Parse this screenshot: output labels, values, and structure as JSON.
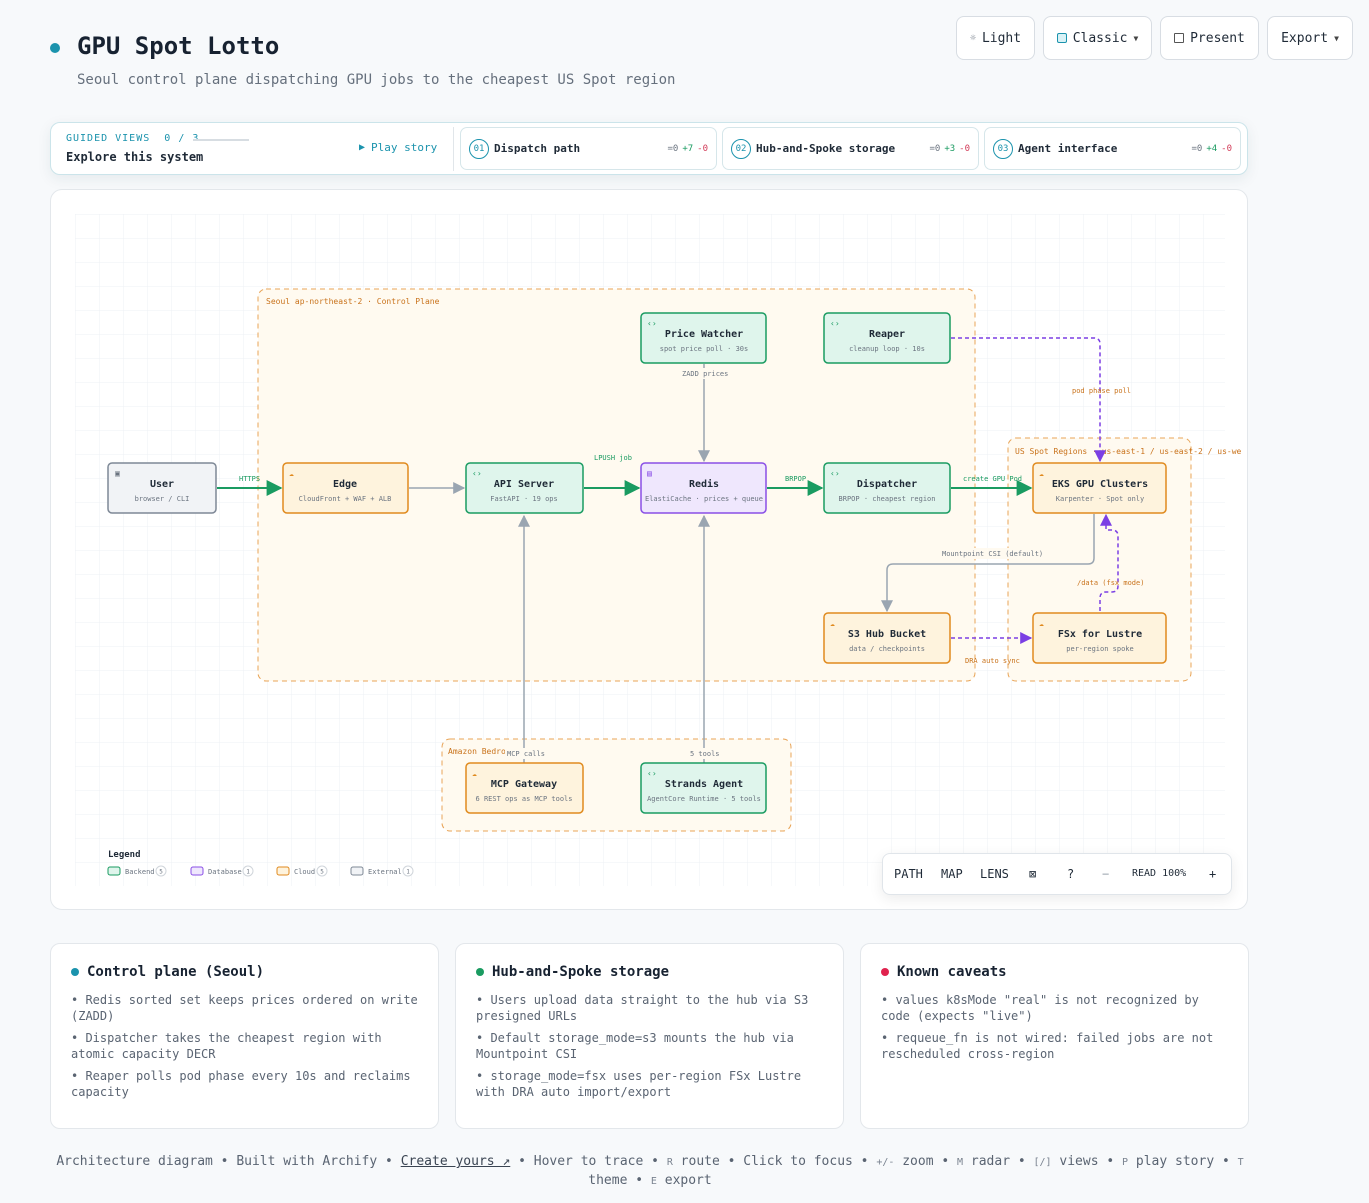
{
  "header": {
    "title": "GPU Spot Lotto",
    "subtitle": "Seoul control plane dispatching GPU jobs to the cheapest US Spot region",
    "accent": "#1b93ad"
  },
  "top_buttons": {
    "light": "Light",
    "classic": "Classic",
    "present": "Present",
    "export": "Export"
  },
  "guided": {
    "label": "GUIDED VIEWS",
    "progress": "0 / 3",
    "explore": "Explore this system",
    "play": "Play story",
    "views": [
      {
        "num": "01",
        "title": "Dispatch path",
        "eq": "=0",
        "plus": "+7",
        "minus": "-0"
      },
      {
        "num": "02",
        "title": "Hub-and-Spoke storage",
        "eq": "=0",
        "plus": "+3",
        "minus": "-0"
      },
      {
        "num": "03",
        "title": "Agent interface",
        "eq": "=0",
        "plus": "+4",
        "minus": "-0"
      }
    ]
  },
  "diagram": {
    "groups": {
      "seoul": "Seoul ap-northeast-2 · Control Plane",
      "us": "US Spot Regions · us-east-1 / us-east-2 / us-we",
      "amazon": "Amazon Bedro    re"
    },
    "nodes": {
      "user": {
        "title": "User",
        "sub": "browser / CLI"
      },
      "edge": {
        "title": "Edge",
        "sub": "CloudFront + WAF + ALB"
      },
      "api": {
        "title": "API Server",
        "sub": "FastAPI · 19 ops"
      },
      "redis": {
        "title": "Redis",
        "sub": "ElastiCache · prices + queue"
      },
      "dispatcher": {
        "title": "Dispatcher",
        "sub": "BRPOP · cheapest region"
      },
      "eks": {
        "title": "EKS GPU Clusters",
        "sub": "Karpenter · Spot only"
      },
      "price": {
        "title": "Price Watcher",
        "sub": "spot price poll · 30s"
      },
      "reaper": {
        "title": "Reaper",
        "sub": "cleanup loop · 10s"
      },
      "s3": {
        "title": "S3 Hub Bucket",
        "sub": "data / checkpoints"
      },
      "fsx": {
        "title": "FSx for Lustre",
        "sub": "per-region spoke"
      },
      "mcp": {
        "title": "MCP Gateway",
        "sub": "6 REST ops as MCP tools"
      },
      "strands": {
        "title": "Strands Agent",
        "sub": "AgentCore Runtime · 5 tools"
      }
    },
    "edges": {
      "https": "HTTPS",
      "lpush": "LPUSH job",
      "brpop": "BRPOP",
      "create": "create GPU Pod",
      "zadd": "ZADD prices",
      "podphase": "pod phase poll",
      "mountpoint": "Mountpoint CSI (default)",
      "datafsx": "/data (fsx mode)",
      "dra": "DRA auto sync",
      "mcpcalls": "MCP calls",
      "tools5": "5 tools"
    },
    "legend": {
      "title": "Legend",
      "items": [
        {
          "label": "Backend",
          "count": "5"
        },
        {
          "label": "Database",
          "count": "1"
        },
        {
          "label": "Cloud",
          "count": "5"
        },
        {
          "label": "External",
          "count": "1"
        }
      ]
    }
  },
  "toolbar": {
    "path": "PATH",
    "map": "MAP",
    "lens": "LENS",
    "help": "?",
    "minus": "−",
    "read": "READ 100%",
    "plus": "+"
  },
  "cards": [
    {
      "title": "Control plane (Seoul)",
      "color": "#1b93ad",
      "items": [
        "• Redis sorted set keeps prices ordered on write (ZADD)",
        "• Dispatcher takes the cheapest region with atomic capacity DECR",
        "• Reaper polls pod phase every 10s and reclaims capacity"
      ]
    },
    {
      "title": "Hub-and-Spoke storage",
      "color": "#1a9b61",
      "items": [
        "• Users upload data straight to the hub via S3 presigned URLs",
        "• Default storage_mode=s3 mounts the hub via Mountpoint CSI",
        "• storage_mode=fsx uses per-region FSx Lustre with DRA auto import/export"
      ]
    },
    {
      "title": "Known caveats",
      "color": "#e0234e",
      "items": [
        "• values k8sMode \"real\" is not recognized by code (expects \"live\")",
        "• requeue_fn is not wired: failed jobs are not rescheduled cross-region"
      ]
    }
  ],
  "footer": {
    "t1": "Architecture diagram • Built with Archify • ",
    "create": "Create yours ↗",
    "t2": " • Hover to trace • ",
    "k_r": "R",
    "t3": " route • Click to focus • ",
    "k_zoom": "+/-",
    "t4": " zoom • ",
    "k_m": "M",
    "t5": " radar • ",
    "k_views": "[/]",
    "t6": " views • ",
    "k_p": "P",
    "t7": " play story • ",
    "k_t": "T",
    "t8": " theme • ",
    "k_e": "E",
    "t9": " export"
  }
}
